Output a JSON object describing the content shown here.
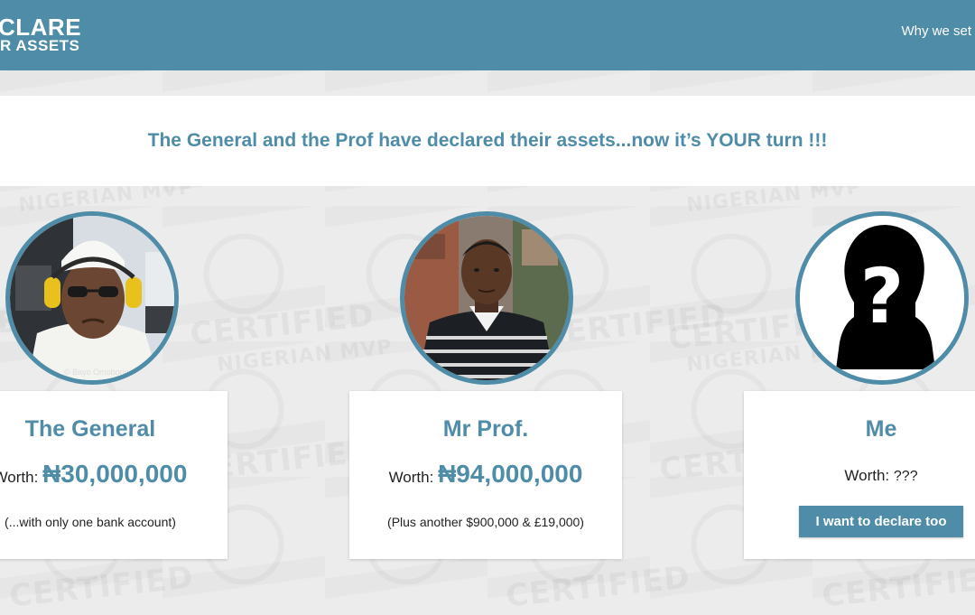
{
  "header": {
    "logo_line1": "CLARE",
    "logo_line2": "R ASSETS",
    "nav_link": "Why we set"
  },
  "banner": {
    "text": "The General and the Prof have declared their assets...now it’s YOUR turn !!!"
  },
  "watermark": {
    "line1": "CERTIFIED",
    "line2": "NIGERIAN MVP"
  },
  "photo_credit": "© Bayo Omoboriowo",
  "cards": [
    {
      "name": "The General",
      "worth_label": "Worth:",
      "worth_value": "₦30,000,000",
      "note": "(...with only one bank account)"
    },
    {
      "name": "Mr Prof.",
      "worth_label": "Worth:",
      "worth_value": "₦94,000,000",
      "note": "(Plus another $900,000 & £19,000)"
    },
    {
      "name": "Me",
      "worth_label": "Worth:",
      "worth_value": "???",
      "button_label": "I want to declare too"
    }
  ],
  "colors": {
    "accent": "#4e8ca8",
    "background": "#ececec"
  }
}
